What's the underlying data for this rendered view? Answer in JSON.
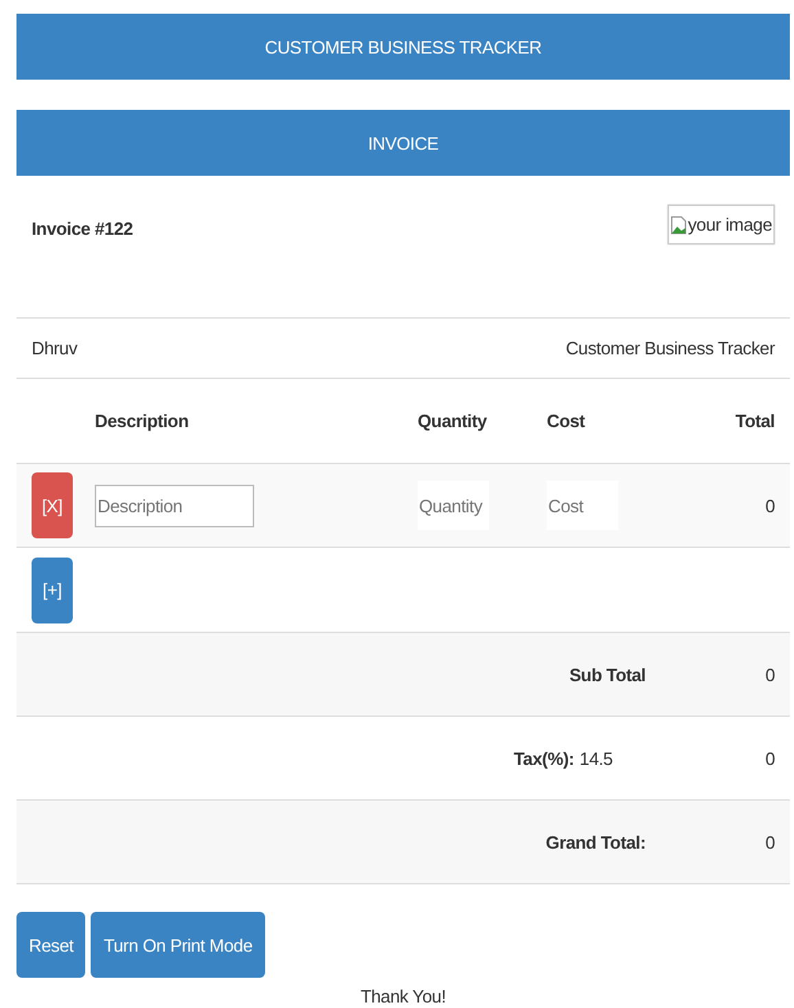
{
  "header": {
    "title": "CUSTOMER BUSINESS TRACKER"
  },
  "banner": {
    "title": "INVOICE"
  },
  "invoice": {
    "number": "Invoice #122",
    "logo_alt": "your image"
  },
  "parties": {
    "customer": "Dhruv",
    "company": "Customer Business Tracker"
  },
  "table": {
    "columns": [
      "Description",
      "Quantity",
      "Cost",
      "Total"
    ],
    "rows": [
      {
        "remove_label": "[X]",
        "description_placeholder": "Description",
        "quantity_placeholder": "Quantity",
        "cost_placeholder": "Cost",
        "total": "0"
      }
    ],
    "add_label": "[+]"
  },
  "summary": [
    {
      "kind": "total",
      "label": "Sub Total",
      "value": "0"
    },
    {
      "kind": "tax",
      "label": "Tax(%):",
      "rate": "14.5",
      "value": "0"
    },
    {
      "kind": "total",
      "label": "Grand Total:",
      "value": "0"
    }
  ],
  "buttons": [
    "Reset",
    "Turn On Print Mode"
  ],
  "footer": "Thank You!"
}
